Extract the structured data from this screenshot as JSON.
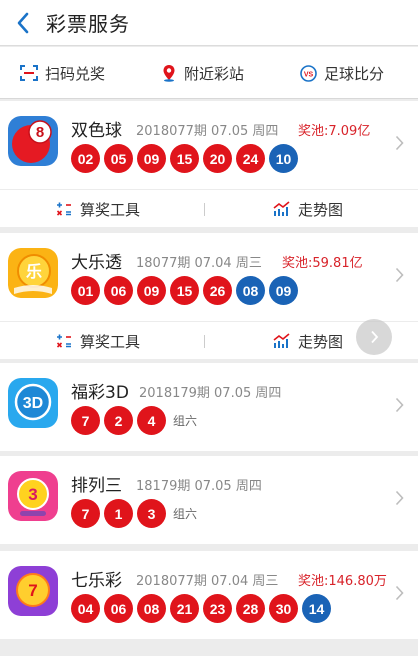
{
  "header": {
    "title": "彩票服务"
  },
  "shortcuts": [
    {
      "label": "扫码兑奖",
      "icon": "scan-icon"
    },
    {
      "label": "附近彩站",
      "icon": "location-pin-icon"
    },
    {
      "label": "足球比分",
      "icon": "vs-icon"
    }
  ],
  "tools": {
    "calc_label": "算奖工具",
    "trend_label": "走势图"
  },
  "lotteries": [
    {
      "name": "双色球",
      "logo_text": "8",
      "issue": "2018077期 07.05 周四",
      "pool": "奖池:7.09亿",
      "red": [
        "02",
        "05",
        "09",
        "15",
        "20",
        "24"
      ],
      "blue": [
        "10"
      ],
      "group": ""
    },
    {
      "name": "大乐透",
      "logo_text": "乐",
      "issue": "18077期 07.04 周三",
      "pool": "奖池:59.81亿",
      "red": [
        "01",
        "06",
        "09",
        "15",
        "26"
      ],
      "blue": [
        "08",
        "09"
      ],
      "group": ""
    },
    {
      "name": "福彩3D",
      "logo_text": "3D",
      "issue": "2018179期 07.05 周四",
      "pool": "",
      "red": [
        "7",
        "2",
        "4"
      ],
      "blue": [],
      "group": "组六"
    },
    {
      "name": "排列三",
      "logo_text": "3",
      "issue": "18179期 07.05 周四",
      "pool": "",
      "red": [
        "7",
        "1",
        "3"
      ],
      "blue": [],
      "group": "组六"
    },
    {
      "name": "七乐彩",
      "logo_text": "7",
      "issue": "2018077期 07.04 周三",
      "pool": "奖池:146.80万",
      "red": [
        "04",
        "06",
        "08",
        "21",
        "23",
        "28",
        "30"
      ],
      "blue": [
        "14"
      ],
      "group": ""
    }
  ],
  "colors": {
    "accent": "#1a73c8",
    "red_ball": "#e0141b",
    "blue_ball": "#1a63b6",
    "pool_text": "#d8232a"
  }
}
